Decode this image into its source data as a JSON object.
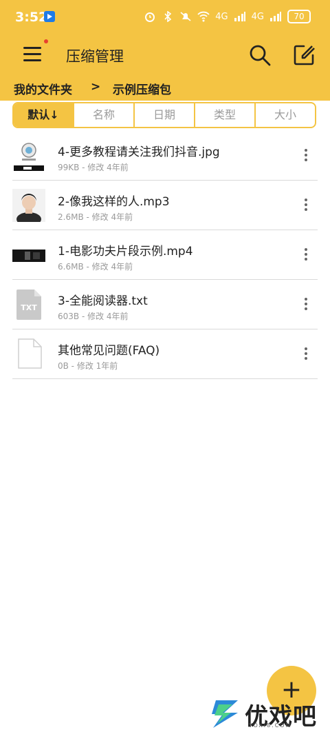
{
  "status_bar": {
    "time": "3:52",
    "battery": "70",
    "signal_1": "4G",
    "signal_2": "4G"
  },
  "header": {
    "title": "压缩管理",
    "menu_icon": "hamburger-menu-icon",
    "search_icon": "search-icon",
    "edit_icon": "edit-icon",
    "accent_color": "#f4c443"
  },
  "breadcrumb": {
    "items": [
      "我的文件夹",
      "示例压缩包"
    ],
    "separator": ">"
  },
  "sort_tabs": [
    {
      "label": "默认↓",
      "active": true
    },
    {
      "label": "名称",
      "active": false
    },
    {
      "label": "日期",
      "active": false
    },
    {
      "label": "类型",
      "active": false
    },
    {
      "label": "大小",
      "active": false
    }
  ],
  "files": [
    {
      "name": "4-更多教程请关注我们抖音.jpg",
      "meta": "99KB - 修改 4年前",
      "icon": "image-thumbnail-icon"
    },
    {
      "name": "2-像我这样的人.mp3",
      "meta": "2.6MB - 修改 4年前",
      "icon": "audio-cover-thumbnail-icon"
    },
    {
      "name": "1-电影功夫片段示例.mp4",
      "meta": "6.6MB - 修改 4年前",
      "icon": "video-thumbnail-icon"
    },
    {
      "name": "3-全能阅读器.txt",
      "meta": "603B - 修改 4年前",
      "icon": "txt-file-icon",
      "icon_label": "TXT"
    },
    {
      "name": "其他常见问题(FAQ)",
      "meta": "0B - 修改 1年前",
      "icon": "blank-file-icon"
    }
  ],
  "fab": {
    "label": "+",
    "icon": "add-icon"
  },
  "watermark": {
    "text": "优戏吧",
    "sub": "YOXI8.COM"
  }
}
